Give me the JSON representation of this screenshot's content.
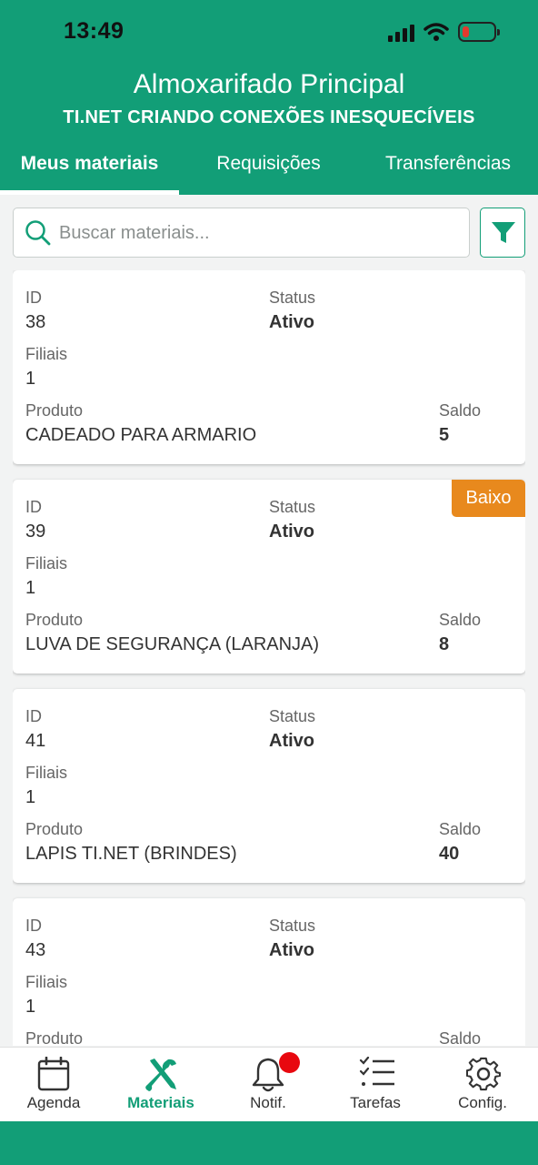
{
  "status_bar": {
    "time": "13:49"
  },
  "header": {
    "title": "Almoxarifado Principal",
    "subtitle": "TI.NET CRIANDO CONEXÕES INESQUECÍVEIS"
  },
  "tabs": [
    {
      "label": "Meus materiais",
      "active": true
    },
    {
      "label": "Requisições",
      "active": false
    },
    {
      "label": "Transferências",
      "active": false
    }
  ],
  "search": {
    "placeholder": "Buscar materiais...",
    "value": ""
  },
  "labels": {
    "id": "ID",
    "status": "Status",
    "filiais": "Filiais",
    "produto": "Produto",
    "saldo": "Saldo"
  },
  "materials": [
    {
      "id": "38",
      "status": "Ativo",
      "filiais": "1",
      "produto": "CADEADO PARA ARMARIO",
      "saldo": "5",
      "badge": ""
    },
    {
      "id": "39",
      "status": "Ativo",
      "filiais": "1",
      "produto": "LUVA DE SEGURANÇA (LARANJA)",
      "saldo": "8",
      "badge": "Baixo"
    },
    {
      "id": "41",
      "status": "Ativo",
      "filiais": "1",
      "produto": "LAPIS TI.NET (BRINDES)",
      "saldo": "40",
      "badge": ""
    },
    {
      "id": "43",
      "status": "Ativo",
      "filiais": "1",
      "produto": "",
      "saldo": "",
      "badge": ""
    }
  ],
  "nav": [
    {
      "label": "Agenda",
      "icon": "calendar-icon",
      "active": false
    },
    {
      "label": "Materiais",
      "icon": "tools-icon",
      "active": true
    },
    {
      "label": "Notif.",
      "icon": "bell-icon",
      "active": false
    },
    {
      "label": "Tarefas",
      "icon": "checklist-icon",
      "active": false
    },
    {
      "label": "Config.",
      "icon": "gear-icon",
      "active": false
    }
  ],
  "colors": {
    "primary": "#129e77",
    "badge": "#e8891d",
    "notification_dot": "#e8080f"
  }
}
